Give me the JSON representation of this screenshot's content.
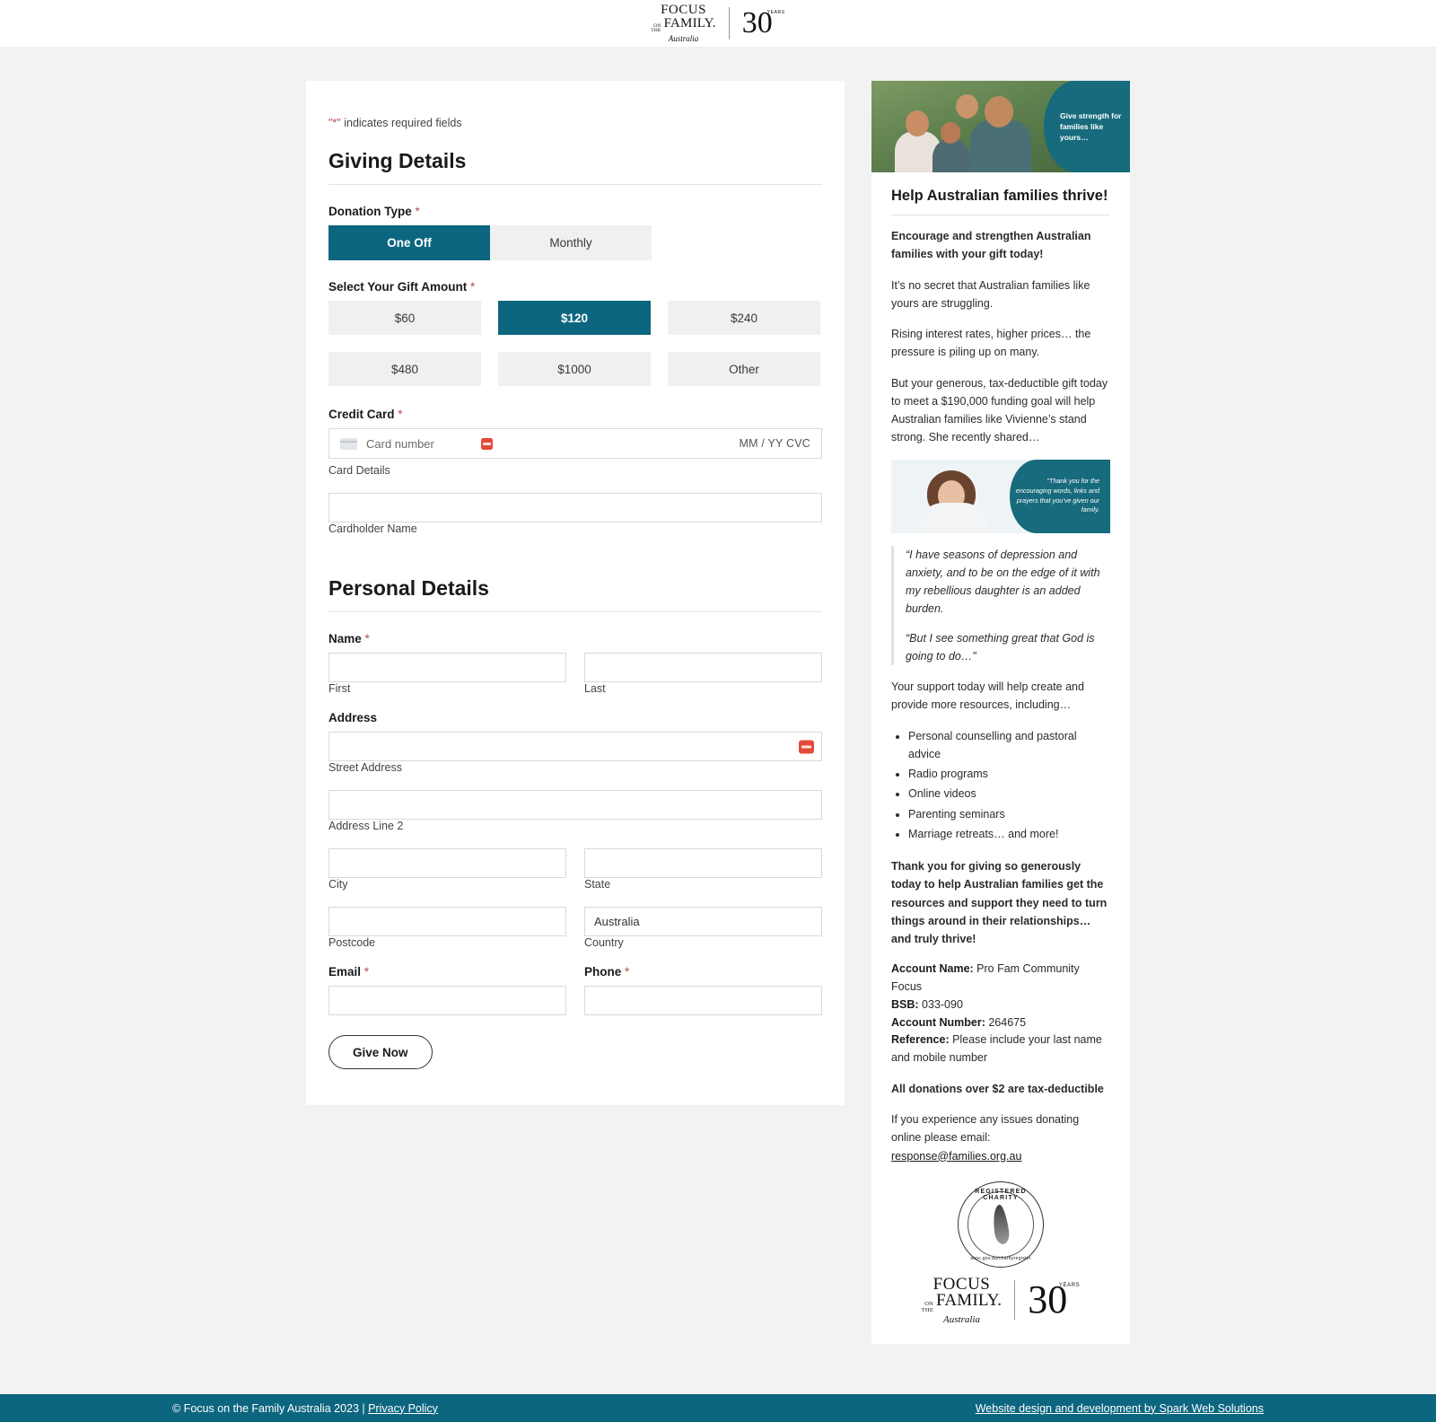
{
  "header": {
    "logo": {
      "line1": "FOCUS",
      "on": "ON",
      "the": "THE",
      "line2": "FAMILY.",
      "line3": "Australia",
      "anniversary": "30",
      "anniversary_sub": "YEARS"
    }
  },
  "form": {
    "required_note_star": "\"*\"",
    "required_note": " indicates required fields",
    "giving_title": "Giving Details",
    "donation_type_label": "Donation Type",
    "donation_types": [
      {
        "label": "One Off",
        "selected": true
      },
      {
        "label": "Monthly",
        "selected": false
      }
    ],
    "gift_amount_label": "Select Your Gift Amount",
    "gift_amounts": [
      {
        "label": "$60",
        "selected": false
      },
      {
        "label": "$120",
        "selected": true
      },
      {
        "label": "$240",
        "selected": false
      },
      {
        "label": "$480",
        "selected": false
      },
      {
        "label": "$1000",
        "selected": false
      },
      {
        "label": "Other",
        "selected": false
      }
    ],
    "credit_card_label": "Credit Card",
    "card_number_placeholder": "Card number",
    "card_expiry_cvc": "MM / YY  CVC",
    "card_details_sublabel": "Card Details",
    "cardholder_name_value": "",
    "cardholder_name_sublabel": "Cardholder Name",
    "personal_title": "Personal Details",
    "name_label": "Name",
    "first_value": "",
    "first_sublabel": "First",
    "last_value": "",
    "last_sublabel": "Last",
    "address_label": "Address",
    "street_value": "",
    "street_sublabel": "Street Address",
    "address2_value": "",
    "address2_sublabel": "Address Line 2",
    "city_value": "",
    "city_sublabel": "City",
    "state_value": "",
    "state_sublabel": "State",
    "postcode_value": "",
    "postcode_sublabel": "Postcode",
    "country_value": "Australia",
    "country_sublabel": "Country",
    "email_label": "Email",
    "email_value": "",
    "phone_label": "Phone",
    "phone_value": "",
    "submit_label": "Give Now",
    "required_marker": "*"
  },
  "sidebar": {
    "hero_overlay_text": "Give strength for families like yours…",
    "title": "Help Australian families thrive!",
    "intro_bold": "Encourage and strengthen Australian families with your gift today!",
    "paragraphs": [
      "It’s no secret that Australian families like yours are struggling.",
      "Rising interest rates, higher prices… the pressure is piling up on many.",
      "But your generous, tax-deductible gift today to meet a $190,000 funding goal will help Australian families like Vivienne’s stand strong. She recently shared…"
    ],
    "testimonial_overlay": "\"Thank you for the encouraging words, links and prayers that you’ve given our family.",
    "quotes": [
      "“I have seasons of depression and anxiety, and to be on the edge of it with my rebellious daughter is an added burden.",
      "“But I see something great that God is going to do…”"
    ],
    "resources_intro": "Your support today will help create and provide more resources, including…",
    "resources": [
      "Personal counselling and pastoral advice",
      "Radio programs",
      "Online videos",
      "Parenting seminars",
      "Marriage retreats… and more!"
    ],
    "thanks_bold": "Thank you for giving so generously today to help Australian families get the resources and support they need to turn things around in their relationships… and truly thrive!",
    "account": {
      "name_label": "Account Name:",
      "name_value": " Pro Fam Community Focus",
      "bsb_label": "BSB:",
      "bsb_value": " 033-090",
      "number_label": "Account Number:",
      "number_value": " 264675",
      "reference_label": "Reference:",
      "reference_value": " Please include your last name and mobile number"
    },
    "tax_note": "All donations over $2 are tax-deductible",
    "issues_text": "If you experience any issues donating online please email: ",
    "email_link": "response@families.org.au",
    "seal_top": "REGISTERED CHARITY",
    "seal_bottom": "acnc.gov.au/charityregister"
  },
  "footer": {
    "copyright": "© Focus on the Family Australia 2023 | ",
    "privacy_label": "Privacy Policy",
    "credit": "Website design and development by Spark Web Solutions"
  },
  "colors": {
    "accent_teal": "#0d6680",
    "required_red": "#b94a48",
    "page_bg": "#f2f2f2"
  }
}
